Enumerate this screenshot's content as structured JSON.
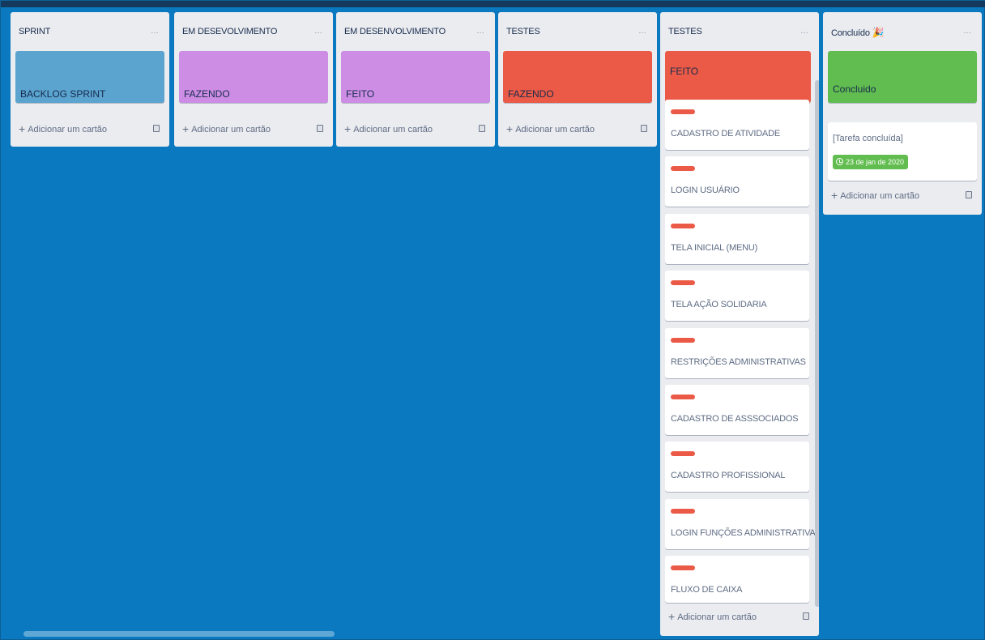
{
  "colors": {
    "board_background": "#0a79bf",
    "list_background": "#ebecf0",
    "blue_label": "#5ba4cf",
    "purple_label": "#cd8de5",
    "red_label": "#eb5a46",
    "green_label": "#61bd4f"
  },
  "common": {
    "menu_icon": "…",
    "add_card_label": "Adicionar um cartão"
  },
  "lists": [
    {
      "title": "SPRINT",
      "card_label": "BACKLOG SPRINT"
    },
    {
      "title": "EM DESEVOLVIMENTO",
      "card_label": "FAZENDO"
    },
    {
      "title": "EM DESENVOLVIMENTO",
      "card_label": "FEITO"
    },
    {
      "title": "TESTES",
      "card_label": "FAZENDO"
    },
    {
      "title": "TESTES",
      "card_label": "FEITO",
      "cards": [
        "CADASTRO DE ATIVIDADE",
        "LOGIN USUÁRIO",
        "TELA INICIAL (MENU)",
        "TELA AÇÃO SOLIDARIA",
        "RESTRIÇÕES ADMINISTRATIVAS",
        "CADASTRO DE ASSSOCIADOS",
        "CADASTRO PROFISSIONAL",
        "LOGIN FUNÇÕES ADMINISTRATIVAS",
        "FLUXO DE CAIXA"
      ]
    },
    {
      "title": "Concluído",
      "title_icon": "party-popper-icon",
      "card_label": "Concluido",
      "done_card": {
        "title": "[Tarefa concluída]",
        "due": "23 de jan de 2020"
      }
    }
  ]
}
